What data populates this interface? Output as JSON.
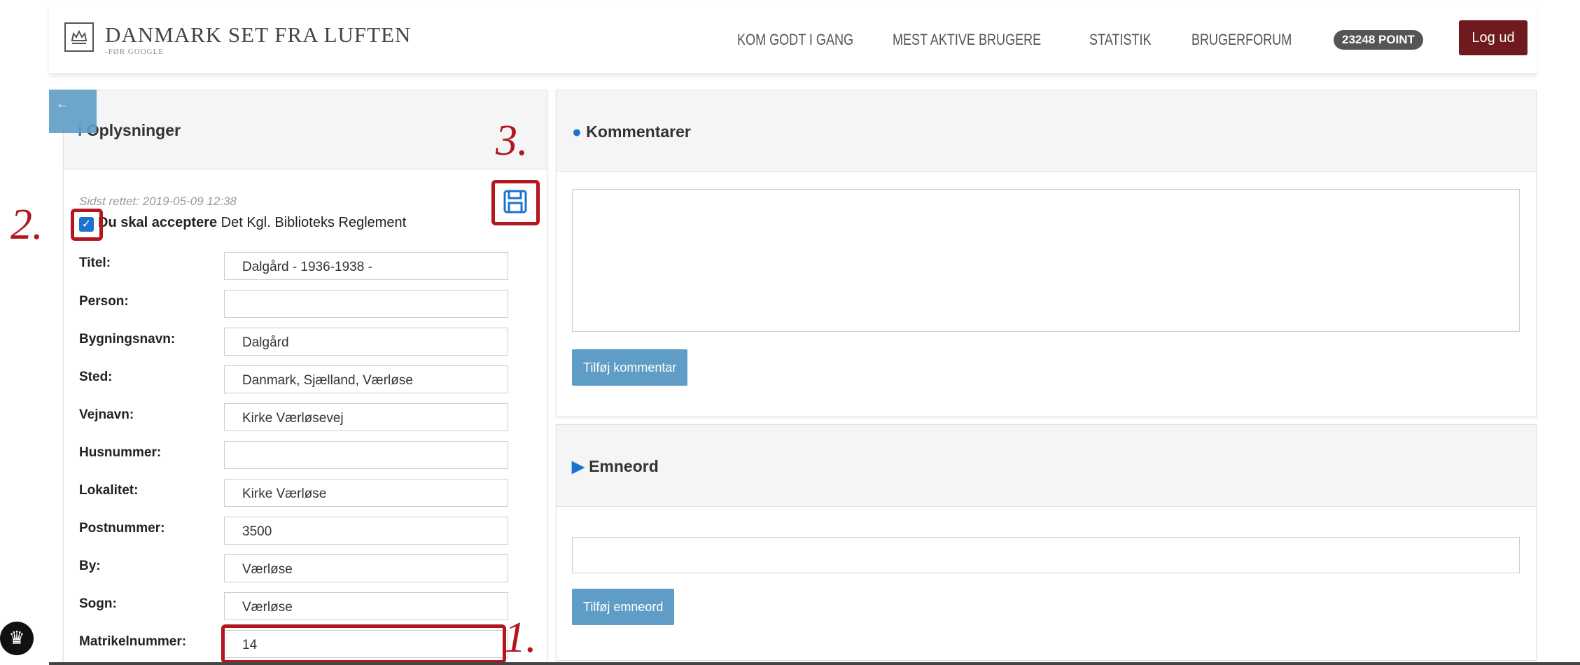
{
  "header": {
    "logo_title": "DANMARK SET FRA LUFTEN",
    "logo_subtitle": "-FØR GOOGLE",
    "nav": [
      "KOM GODT I GANG",
      "MEST AKTIVE BRUGERE",
      "STATISTIK",
      "BRUGERFORUM"
    ],
    "points_badge": "23248 POINT",
    "logout_label": "Log ud"
  },
  "info_panel": {
    "title": "Oplysninger",
    "last_edited": "Sidst rettet: 2019-05-09 12:38",
    "accept_bold": "Du skal acceptere",
    "accept_rest": " Det Kgl. Biblioteks Reglement",
    "accept_checked": true,
    "fields": [
      {
        "label": "Titel:",
        "value": "Dalgård - 1936-1938 -"
      },
      {
        "label": "Person:",
        "value": ""
      },
      {
        "label": "Bygningsnavn:",
        "value": "Dalgård"
      },
      {
        "label": "Sted:",
        "value": "Danmark, Sjælland, Værløse"
      },
      {
        "label": "Vejnavn:",
        "value": "Kirke Værløsevej"
      },
      {
        "label": "Husnummer:",
        "value": ""
      },
      {
        "label": "Lokalitet:",
        "value": "Kirke Værløse"
      },
      {
        "label": "Postnummer:",
        "value": "3500"
      },
      {
        "label": "By:",
        "value": "Værløse"
      },
      {
        "label": "Sogn:",
        "value": "Værløse"
      },
      {
        "label": "Matrikelnummer:",
        "value": "14"
      }
    ]
  },
  "comments_panel": {
    "title": "Kommentarer",
    "textarea_value": "",
    "button_label": "Tilføj kommentar"
  },
  "keywords_panel": {
    "title": "Emneord",
    "input_value": "",
    "button_label": "Tilføj emneord"
  },
  "annotations": {
    "step1": "1.",
    "step2": "2.",
    "step3": "3."
  },
  "colors": {
    "accent_blue": "#5f9dc7",
    "logout_red": "#6e1a1e",
    "annotation_red": "#b3161f"
  }
}
